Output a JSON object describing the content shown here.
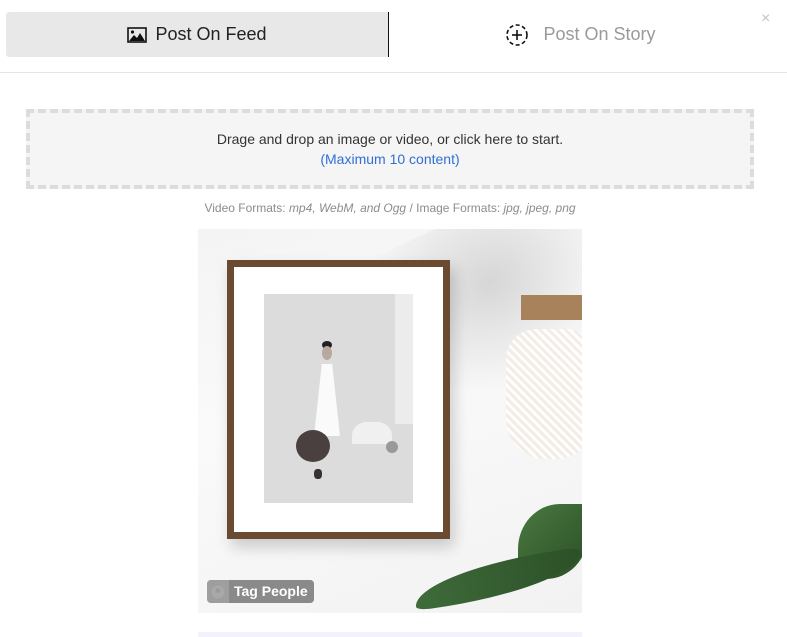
{
  "tabs": {
    "feed": {
      "label": "Post On Feed",
      "icon": "image-icon",
      "active": true
    },
    "story": {
      "label": "Post On Story",
      "icon": "dashed-circle-plus-icon",
      "active": false
    }
  },
  "close": {
    "icon": "close-icon",
    "glyph": "×"
  },
  "dropzone": {
    "main_text": "Drage and drop an image or video, or click here to start.",
    "max_text": "(Maximum 10 content)",
    "link_color": "#2f6fd6"
  },
  "formats": {
    "video_label": "Video Formats: ",
    "video_values": "mp4, WebM, and Ogg",
    "separator": " / ",
    "image_label": "Image Formats: ",
    "image_values": "jpg, jpeg, png"
  },
  "media": {
    "description": "Framed illustration of a woman on a white wall with a hanging net bag and plant leaves",
    "tag_people_label": "Tag People",
    "tag_icon": "user-icon"
  }
}
